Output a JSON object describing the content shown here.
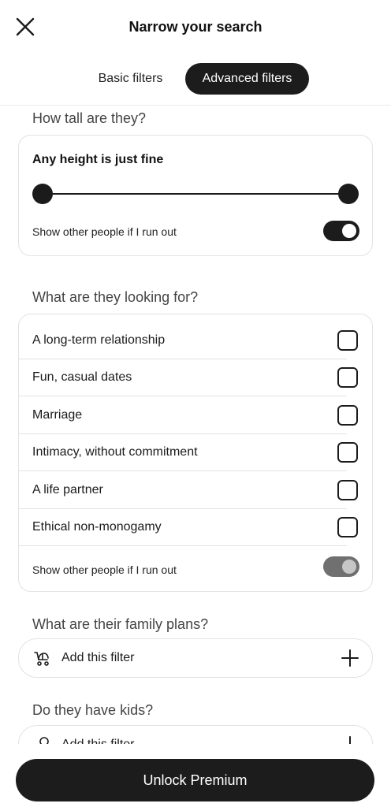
{
  "header": {
    "title": "Narrow your search",
    "close_icon": "close-icon"
  },
  "tabs": [
    {
      "label": "Basic filters",
      "active": false
    },
    {
      "label": "Advanced filters",
      "active": true
    }
  ],
  "height_section": {
    "heading": "How tall are they?",
    "label": "Any height is just fine",
    "toggle_label": "Show other people if I run out",
    "toggle_on": true
  },
  "looking_section": {
    "heading": "What are they looking for?",
    "options": [
      {
        "label": "A long-term relationship",
        "checked": false
      },
      {
        "label": "Fun, casual dates",
        "checked": false
      },
      {
        "label": "Marriage",
        "checked": false
      },
      {
        "label": "Intimacy, without commitment",
        "checked": false
      },
      {
        "label": "A life partner",
        "checked": false
      },
      {
        "label": "Ethical non-monogamy",
        "checked": false
      }
    ],
    "toggle_label": "Show other people if I run out",
    "toggle_on": false
  },
  "family_section": {
    "heading": "What are their family plans?",
    "filter_label": "Add this filter",
    "icon": "stroller-icon"
  },
  "kids_section": {
    "heading": "Do they have kids?",
    "filter_label": "Add this filter",
    "icon": "rattle-icon"
  },
  "cta": {
    "label": "Unlock Premium"
  },
  "colors": {
    "primary": "#1c1c1c",
    "background": "#ffffff",
    "border": "#e2e2e2",
    "toggle_off": "#707070"
  }
}
